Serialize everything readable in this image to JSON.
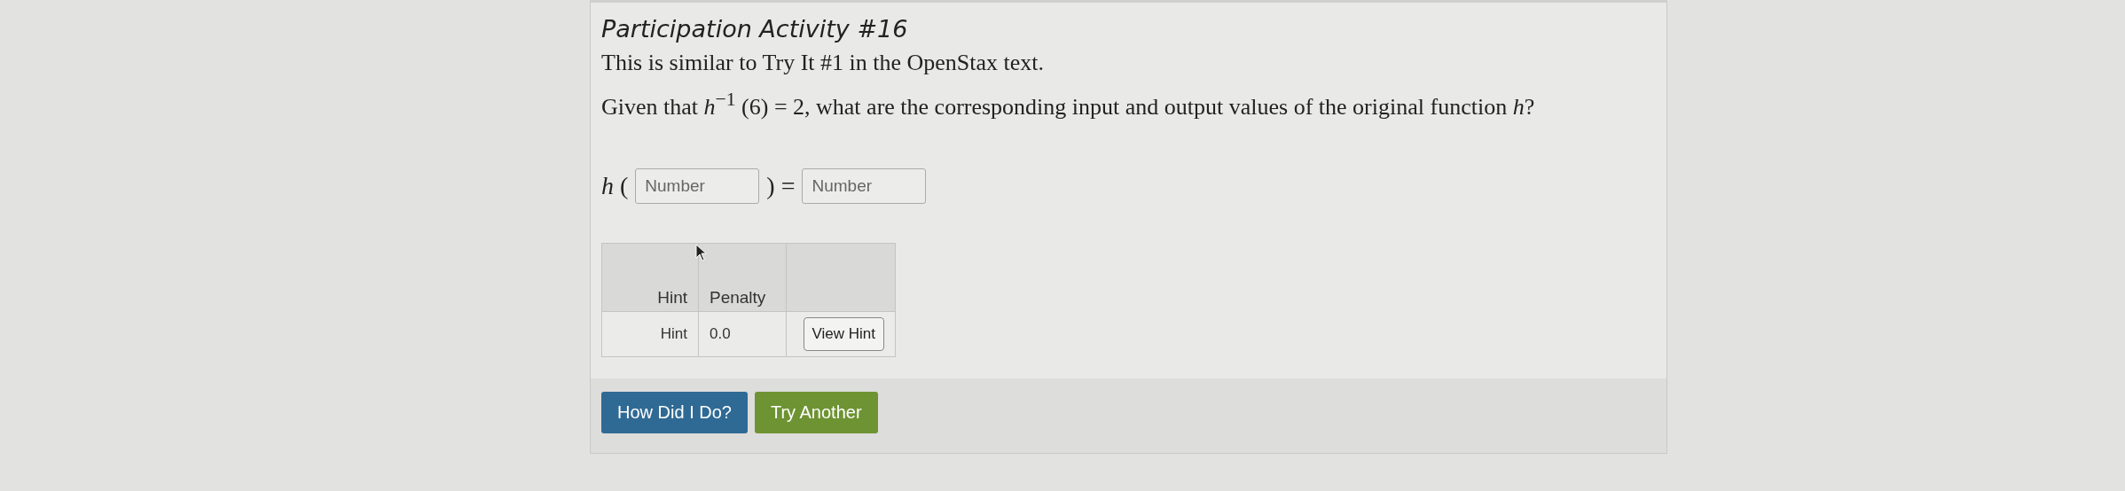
{
  "title": "Participation Activity #16",
  "intro": "This is similar to Try It #1 in the OpenStax text.",
  "question": "Given that *h*$^{−1}$ (6) = 2, what are the corresponding input and output values of the original function *h*?",
  "equation": {
    "parts": [
      {
        "kind": "text",
        "text": "*h* ("
      },
      {
        "kind": "input",
        "placeholder": "Number"
      },
      {
        "kind": "text",
        "text": ") ="
      },
      {
        "kind": "input",
        "placeholder": "Number"
      }
    ]
  },
  "hint_table": {
    "columns": [
      "Hint",
      "Penalty"
    ],
    "rows": [
      {
        "hint": "Hint",
        "penalty": "0.0",
        "action": "View Hint"
      }
    ]
  },
  "buttons": [
    {
      "label": "How Did I Do?",
      "kind": "primary"
    },
    {
      "label": "Try Another",
      "kind": "success"
    }
  ]
}
